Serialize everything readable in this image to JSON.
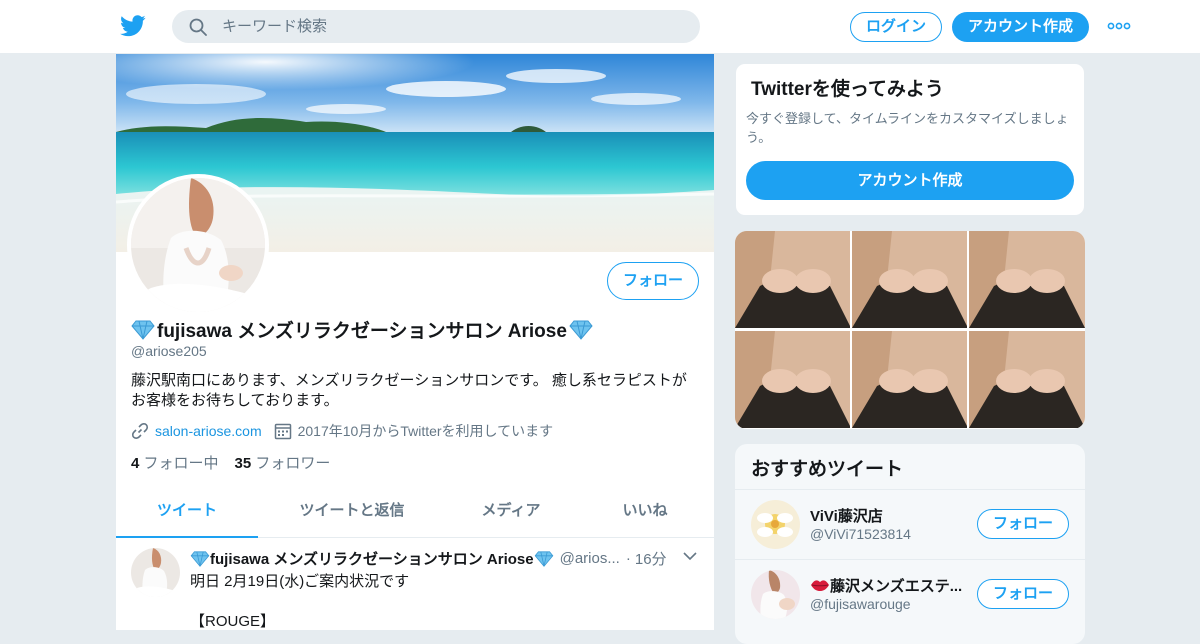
{
  "header": {
    "search_placeholder": "キーワード検索",
    "login_label": "ログイン",
    "signup_label": "アカウント作成"
  },
  "profile": {
    "name": "fujisawa メンズリラクゼーションサロン Ariose",
    "handle": "@ariose205",
    "bio": "藤沢駅南口にあります、メンズリラクゼーションサロンです。 癒し系セラピストがお客様をお待ちしております。",
    "link": "salon-ariose.com",
    "joined": "2017年10月からTwitterを利用しています",
    "following_count": "4",
    "following_label": "フォロー中",
    "followers_count": "35",
    "followers_label": "フォロワー",
    "follow_label": "フォロー"
  },
  "tabs": [
    {
      "label": "ツイート"
    },
    {
      "label": "ツイートと返信"
    },
    {
      "label": "メディア"
    },
    {
      "label": "いいね"
    }
  ],
  "tweet": {
    "name": "fujisawa メンズリラクゼーションサロン Ariose",
    "handle": "@arios...",
    "separator": "·",
    "time": "16分",
    "body": "明日 2月19日(水)ご案内状況です\n\n【ROUGE】"
  },
  "sidebar": {
    "try_title": "Twitterを使ってみよう",
    "try_text": "今すぐ登録して、タイムラインをカスタマイズしましょう。",
    "try_button": "アカウント作成",
    "reco_title": "おすすめツイート",
    "reco": [
      {
        "name": "ViVi藤沢店",
        "handle": "@ViVi71523814",
        "follow": "フォロー"
      },
      {
        "name": "藤沢メンズエステ...",
        "handle": "@fujisawarouge",
        "follow": "フォロー"
      }
    ]
  },
  "colors": {
    "accent": "#1da1f2",
    "text": "#14171a",
    "muted": "#657786",
    "background": "#e6ecf0"
  }
}
